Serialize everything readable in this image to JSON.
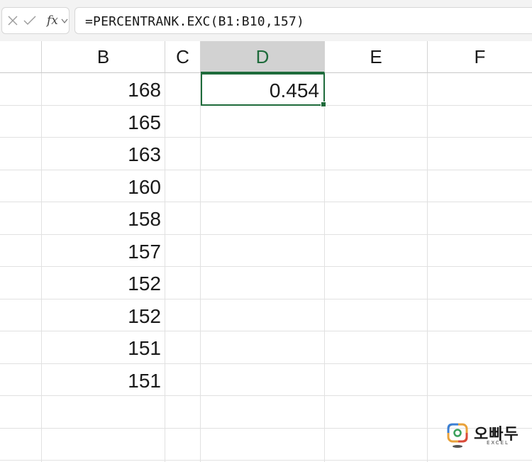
{
  "formula_bar": {
    "fx_label": "fx",
    "formula": "=PERCENTRANK.EXC(B1:B10,157)"
  },
  "columns": [
    "B",
    "C",
    "D",
    "E",
    "F"
  ],
  "selected_column": "D",
  "cells": {
    "B": [
      "168",
      "165",
      "163",
      "160",
      "158",
      "157",
      "152",
      "152",
      "151",
      "151"
    ],
    "D1": "0.454"
  },
  "logo": {
    "title": "오빠두",
    "subtitle": "EXCEL"
  },
  "colors": {
    "accent_green": "#1e6b3b",
    "selected_header_bg": "#d2d2d2",
    "gridline": "#e1e1e1"
  }
}
